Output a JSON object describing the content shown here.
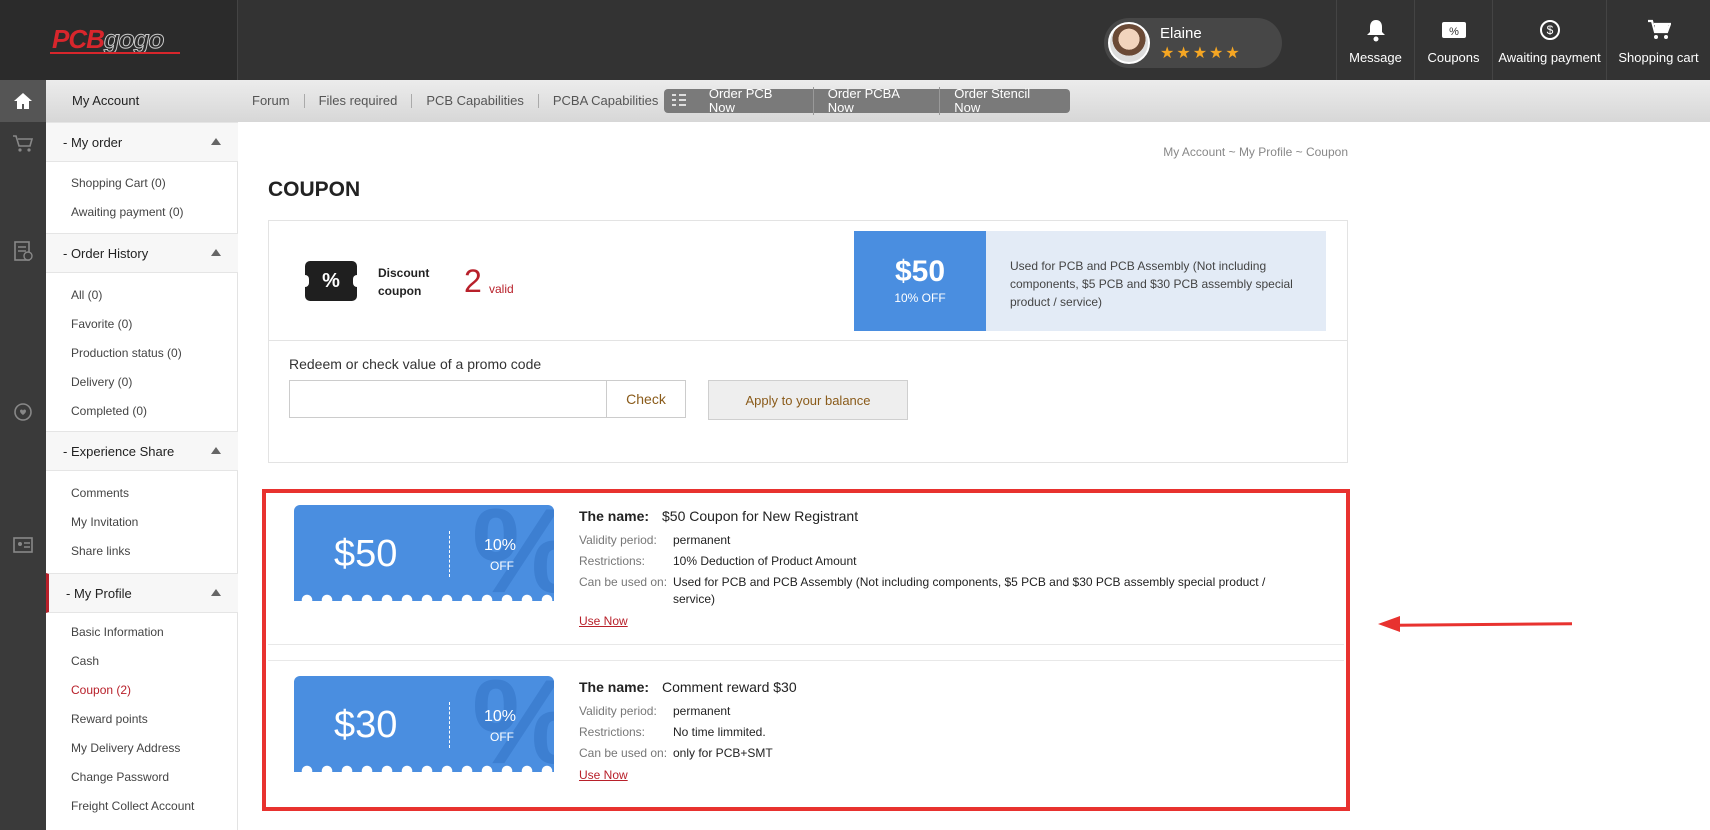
{
  "header": {
    "logo_pcb": "PCB",
    "logo_gogo": "gogo",
    "user": {
      "name": "Elaine",
      "stars": "★★★★★"
    },
    "icons": [
      {
        "name": "bell-icon",
        "glyph": "🔔",
        "label": "Message"
      },
      {
        "name": "coupon-icon",
        "glyph": "%",
        "label": "Coupons"
      },
      {
        "name": "dollar-coin-icon",
        "glyph": "$",
        "label": "Awaiting payment"
      },
      {
        "name": "cart-icon",
        "glyph": "🛒",
        "label": "Shopping cart"
      }
    ]
  },
  "subnav": {
    "my_account": "My Account",
    "links": [
      "Forum",
      "Files required",
      "PCB Capabilities",
      "PCBA Capabilities"
    ],
    "order_links": [
      "Order PCB Now",
      "Order PCBA Now",
      "Order Stencil Now"
    ]
  },
  "sidebar": {
    "sections": [
      {
        "title": "- My order",
        "items": [
          "Shopping Cart (0)",
          "Awaiting payment (0)"
        ]
      },
      {
        "title": "- Order History",
        "items": [
          "All (0)",
          "Favorite (0)",
          "Production status (0)",
          "Delivery (0)",
          "Completed (0)"
        ]
      },
      {
        "title": "- Experience Share",
        "items": [
          "Comments",
          "My Invitation",
          "Share links"
        ]
      },
      {
        "title": "- My Profile",
        "items": [
          "Basic Information",
          "Cash",
          "Coupon (2)",
          "Reward points",
          "My Delivery Address",
          "Change Password",
          "Freight Collect Account"
        ]
      }
    ]
  },
  "main": {
    "breadcrumb": "My Account  ~  My Profile  ~  Coupon",
    "title": "COUPON",
    "summary": {
      "discount_label": "Discount coupon",
      "valid_count": "2",
      "valid_word": "valid",
      "mini_amount": "$50",
      "mini_off": "10% OFF",
      "mini_desc": "Used for PCB and PCB Assembly (Not including components, $5 PCB and $30 PCB assembly special product / service)"
    },
    "promo": {
      "label": "Redeem or check value of a promo code",
      "input_value": "",
      "check_label": "Check",
      "apply_label": "Apply to your balance"
    },
    "coupons": [
      {
        "amount": "$50",
        "pct": "10%",
        "off": "OFF",
        "name_label": "The name:",
        "name": "$50 Coupon for New Registrant",
        "validity_label": "Validity period:",
        "validity": "permanent",
        "restrictions_label": "Restrictions:",
        "restrictions": "10% Deduction of Product Amount",
        "usage_label": "Can be used on:",
        "usage": "Used for PCB and PCB Assembly (Not including components, $5 PCB and $30 PCB assembly special product / service)",
        "use_now": "Use Now"
      },
      {
        "amount": "$30",
        "pct": "10%",
        "off": "OFF",
        "name_label": "The name:",
        "name": "Comment reward $30",
        "validity_label": "Validity period:",
        "validity": "permanent",
        "restrictions_label": "Restrictions:",
        "restrictions": "No time limmited.",
        "usage_label": "Can be used on:",
        "usage": "only for PCB+SMT",
        "use_now": "Use Now"
      }
    ]
  },
  "colors": {
    "accent_red": "#b8202a",
    "coupon_blue": "#4a8ee0",
    "highlight": "#e8322f"
  }
}
